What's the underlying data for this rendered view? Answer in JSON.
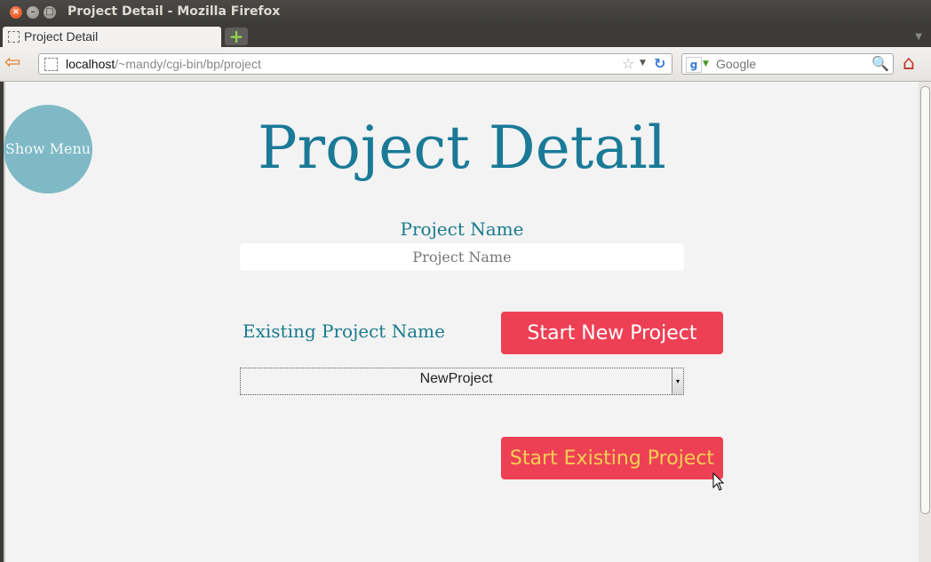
{
  "window": {
    "title": "Project Detail - Mozilla Firefox",
    "close_glyph": "×",
    "min_glyph": "–",
    "max_glyph": "□"
  },
  "tabs": [
    {
      "label": "Project Detail"
    }
  ],
  "tabbar": {
    "new_tab_glyph": "+",
    "menu_glyph": "▼"
  },
  "navbar": {
    "url_host": "localhost",
    "url_path": "/~mandy/cgi-bin/bp/project",
    "search_placeholder": "Google",
    "search_engine_glyph": "g",
    "back_glyph": "⇦",
    "star_glyph": "☆",
    "drop_glyph": "▼",
    "reload_glyph": "↻",
    "search_glyph": "🔍",
    "home_glyph": "⌂"
  },
  "page": {
    "show_menu_label": "Show Menu",
    "title": "Project Detail",
    "project_name_label": "Project Name",
    "project_name_placeholder": "Project Name",
    "existing_label": "Existing Project Name",
    "start_new_label": "Start New Project",
    "existing_selected": "NewProject",
    "select_arrow_glyph": "▾",
    "start_existing_label": "Start Existing Project"
  },
  "colors": {
    "title": "#1a7a97",
    "label": "#197a8c",
    "button": "#ee4055",
    "menu_circle": "#7fb9c6",
    "existing_button_text": "#f3cf52"
  },
  "icons": [
    "back-arrow-icon",
    "site-icon",
    "bookmark-star-icon",
    "reload-icon",
    "google-icon",
    "search-icon",
    "home-icon",
    "mouse-cursor-icon"
  ]
}
